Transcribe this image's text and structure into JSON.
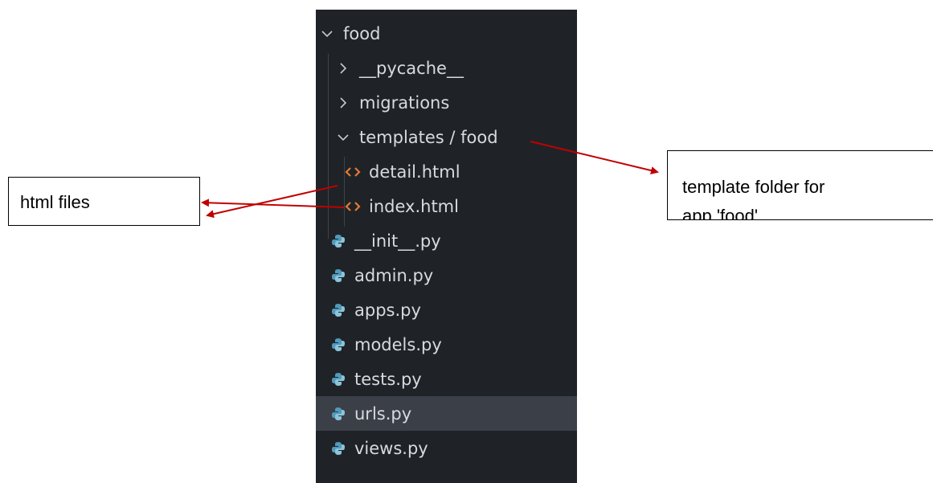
{
  "explorer": {
    "root_folder": "food",
    "items": [
      {
        "label": "__pycache__",
        "type": "folder",
        "state": "collapsed"
      },
      {
        "label": "migrations",
        "type": "folder",
        "state": "collapsed"
      },
      {
        "label": "templates / food",
        "type": "folder",
        "state": "expanded"
      },
      {
        "label": "detail.html",
        "type": "html-file"
      },
      {
        "label": "index.html",
        "type": "html-file"
      },
      {
        "label": "__init__.py",
        "type": "python-file"
      },
      {
        "label": "admin.py",
        "type": "python-file"
      },
      {
        "label": "apps.py",
        "type": "python-file"
      },
      {
        "label": "models.py",
        "type": "python-file"
      },
      {
        "label": "tests.py",
        "type": "python-file"
      },
      {
        "label": "urls.py",
        "type": "python-file",
        "selected": true
      },
      {
        "label": "views.py",
        "type": "python-file"
      }
    ]
  },
  "annotations": {
    "left_callout": "html files",
    "right_callout_line1": "template folder for",
    "right_callout_line2": "app 'food'"
  },
  "colors": {
    "explorer_bg": "#1f2327",
    "text": "#d7dae0",
    "selected_bg": "#3b3f47",
    "html_icon": "#e37933",
    "python_icon": "#519aba",
    "arrow": "#c00000"
  }
}
